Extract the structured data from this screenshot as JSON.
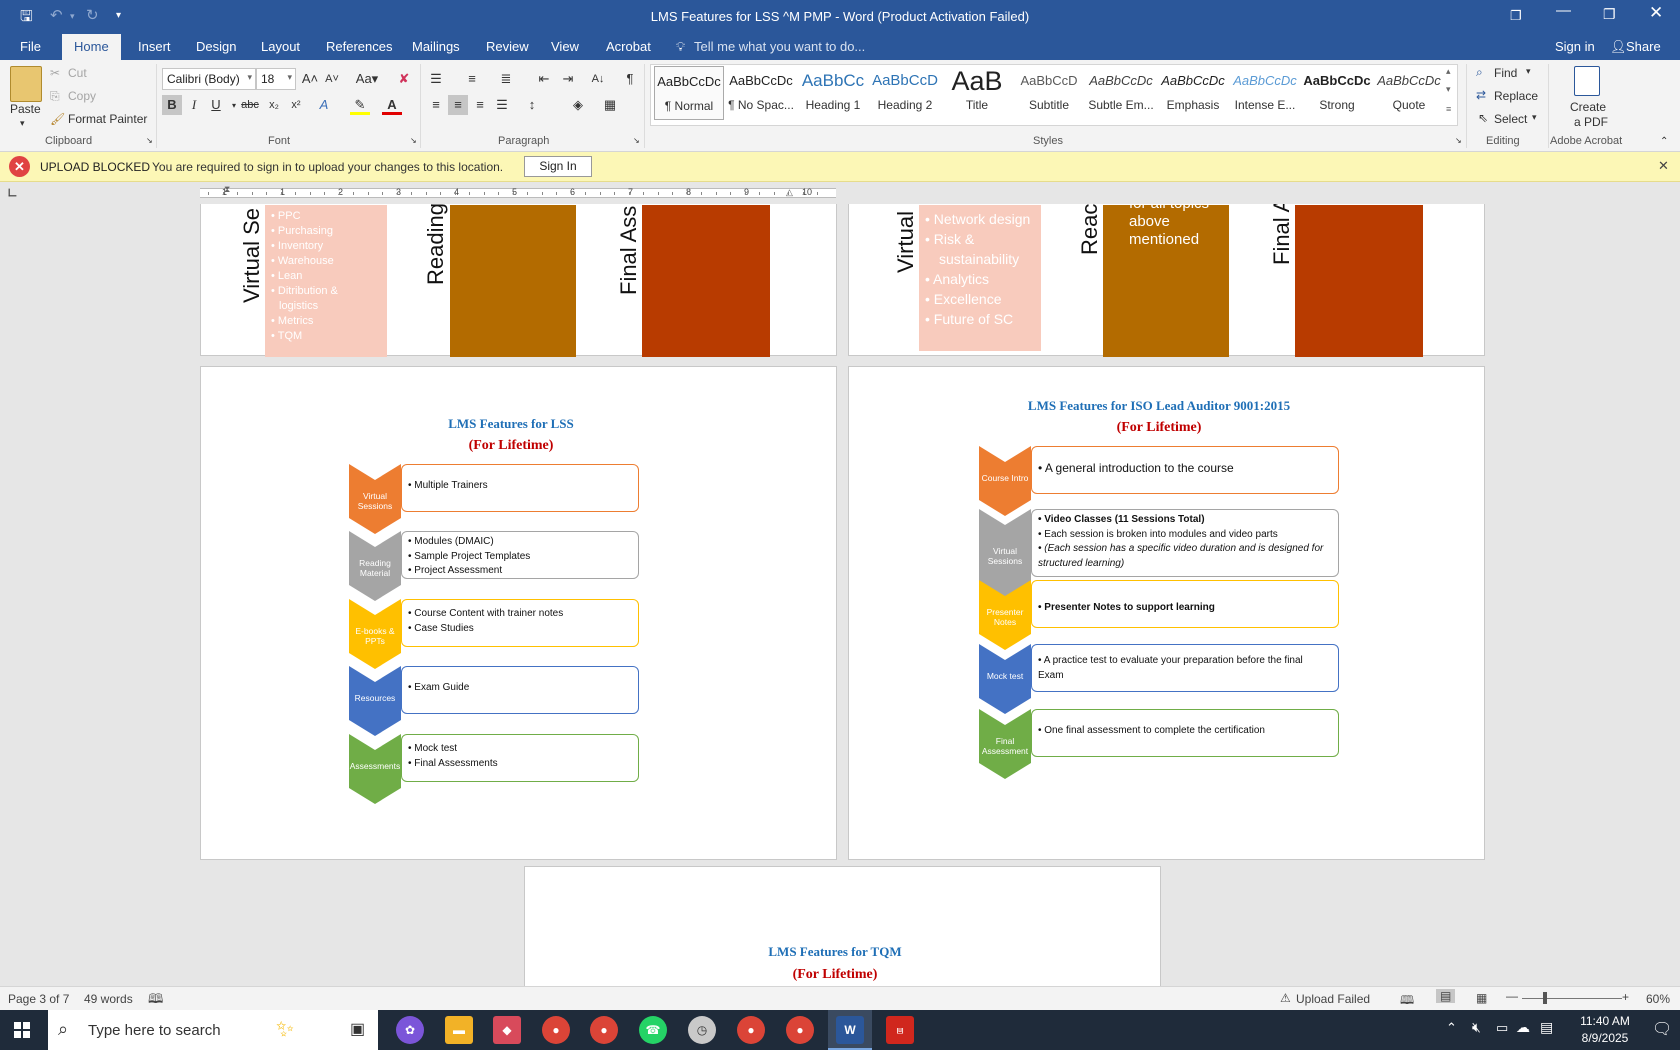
{
  "window": {
    "title": "LMS Features for LSS ^M PMP  -  Word (Product Activation Failed)",
    "controls": [
      "ribbon-display-icon",
      "minimize-icon",
      "restore-icon",
      "close-icon"
    ]
  },
  "ribbon_tabs": [
    "File",
    "Home",
    "Insert",
    "Design",
    "Layout",
    "References",
    "Mailings",
    "Review",
    "View",
    "Acrobat"
  ],
  "tell_me": "Tell me what you want to do...",
  "sign_in": "Sign in",
  "share": "Share",
  "clipboard": {
    "paste": "Paste",
    "cut": "Cut",
    "copy": "Copy",
    "format_painter": "Format Painter",
    "label": "Clipboard"
  },
  "font": {
    "name": "Calibri (Body)",
    "size": "18",
    "label": "Font"
  },
  "paragraph": {
    "label": "Paragraph"
  },
  "styles": {
    "label": "Styles",
    "items": [
      {
        "preview": "AaBbCcDc",
        "name": "¶ Normal"
      },
      {
        "preview": "AaBbCcDc",
        "name": "¶ No Spac..."
      },
      {
        "preview": "AaBbCc",
        "name": "Heading 1"
      },
      {
        "preview": "AaBbCcD",
        "name": "Heading 2"
      },
      {
        "preview": "AaB",
        "name": "Title"
      },
      {
        "preview": "AaBbCcD",
        "name": "Subtitle"
      },
      {
        "preview": "AaBbCcDc",
        "name": "Subtle Em..."
      },
      {
        "preview": "AaBbCcDc",
        "name": "Emphasis"
      },
      {
        "preview": "AaBbCcDc",
        "name": "Intense E..."
      },
      {
        "preview": "AaBbCcDc",
        "name": "Strong"
      },
      {
        "preview": "AaBbCcDc",
        "name": "Quote"
      }
    ]
  },
  "editing": {
    "find": "Find",
    "replace": "Replace",
    "select": "Select",
    "label": "Editing"
  },
  "acrobat": {
    "create_pdf_line1": "Create",
    "create_pdf_line2": "a PDF",
    "label": "Adobe Acrobat"
  },
  "message_bar": {
    "title": "UPLOAD BLOCKED",
    "text": "You are required to sign in to upload your changes to this location.",
    "button": "Sign In"
  },
  "ruler": {
    "numbers": [
      "1",
      "1",
      "2",
      "3",
      "4",
      "5",
      "6",
      "7",
      "8",
      "9",
      "10"
    ]
  },
  "top_pages": {
    "left": {
      "vlabels": [
        "Virtual Se",
        "Reading",
        "Final Ass"
      ],
      "bullets": [
        "PPC",
        "Purchasing",
        "Inventory",
        "Warehouse",
        "Lean",
        "Ditribution &",
        "logistics",
        "Metrics",
        "TQM"
      ]
    },
    "right": {
      "vlabels": [
        "Virtual",
        "Reac",
        "Final A"
      ],
      "bullets": [
        "Network design",
        "Risk &",
        "sustainability",
        "Analytics",
        "Excellence",
        "Future of SC"
      ],
      "cut_text": [
        "for all topics",
        "above",
        "mentioned"
      ]
    }
  },
  "lss_page": {
    "title": "LMS Features for LSS",
    "subtitle": "(For Lifetime)",
    "rows": [
      {
        "label": "Virtual Sessions",
        "lines": [
          "• Multiple Trainers"
        ]
      },
      {
        "label": "Reading Material",
        "lines": [
          "• Modules (DMAIC)",
          "• Sample Project Templates",
          "• Project Assessment"
        ]
      },
      {
        "label": "E-books & PPTs",
        "lines": [
          "• Course Content with trainer notes",
          "• Case Studies"
        ]
      },
      {
        "label": "Resources",
        "lines": [
          "• Exam Guide"
        ]
      },
      {
        "label": "Assessments",
        "lines": [
          "• Mock test",
          "• Final Assessments"
        ]
      }
    ]
  },
  "iso_page": {
    "title": "LMS Features for ISO Lead Auditor 9001:2015",
    "subtitle": "(For Lifetime)",
    "rows": [
      {
        "label": "Course Intro",
        "lines": [
          "•    A general introduction to the course"
        ]
      },
      {
        "label": "Virtual Sessions",
        "lines": [
          "• Video Classes (11 Sessions Total)",
          "• Each session is broken into modules and video parts",
          "• (Each session has a specific video duration and is designed for",
          "   structured learning)"
        ]
      },
      {
        "label": "Presenter Notes",
        "lines": [
          "• Presenter Notes to support learning"
        ]
      },
      {
        "label": "Mock test",
        "lines": [
          "•  A practice test to evaluate your  preparation before the final",
          "   Exam"
        ]
      },
      {
        "label": "Final Assessment",
        "lines": [
          "• One final assessment to complete the certification"
        ]
      }
    ]
  },
  "tqm_page": {
    "title": "LMS Features for TQM",
    "subtitle": "(For Lifetime)"
  },
  "colors": {
    "orange": "#ed7d31",
    "gray": "#a5a5a5",
    "gold": "#ffc000",
    "blue": "#4472c4",
    "green": "#70ad47",
    "brand": "#2b579a"
  },
  "status": {
    "page": "Page 3 of 7",
    "words": "49 words",
    "upload": "Upload Failed",
    "zoom": "60%"
  },
  "taskbar": {
    "search": "Type here to search",
    "time": "11:40 AM",
    "date": "8/9/2025"
  }
}
